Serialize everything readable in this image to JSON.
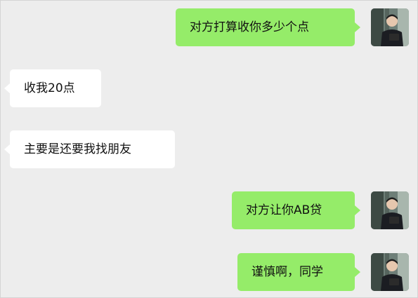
{
  "chat": {
    "messages": [
      {
        "side": "sent",
        "text": "对方打算收你多少个点",
        "avatar": "user-avatar-photo"
      },
      {
        "side": "received",
        "text": "收我20点"
      },
      {
        "side": "received",
        "text": "主要是还要我找朋友"
      },
      {
        "side": "sent",
        "text": "对方让你AB贷",
        "avatar": "user-avatar-photo"
      },
      {
        "side": "sent",
        "text": "谨慎啊，同学",
        "avatar": "user-avatar-photo"
      }
    ]
  },
  "colors": {
    "background": "#ededed",
    "sent_bubble": "#95ec69",
    "received_bubble": "#ffffff"
  }
}
